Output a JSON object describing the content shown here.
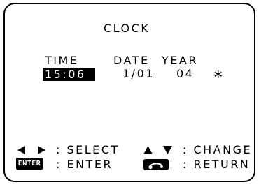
{
  "screen": {
    "title": "CLOCK",
    "headers": {
      "time": "TIME",
      "date": "DATE",
      "year": "YEAR"
    },
    "values": {
      "time": "15:06",
      "date": "1/01",
      "year": "04",
      "marker": "∗"
    }
  },
  "help": {
    "select_label": ": SELECT",
    "change_label": ": CHANGE",
    "enter_key": "ENTER",
    "enter_label": ": ENTER",
    "return_label": ": RETURN"
  },
  "icons": {
    "select": "left-right-arrows-icon",
    "change": "up-down-arrows-icon",
    "enter": "enter-key-icon",
    "return": "return-key-icon"
  },
  "colors": {
    "background": "#ffffff",
    "foreground": "#000000"
  }
}
